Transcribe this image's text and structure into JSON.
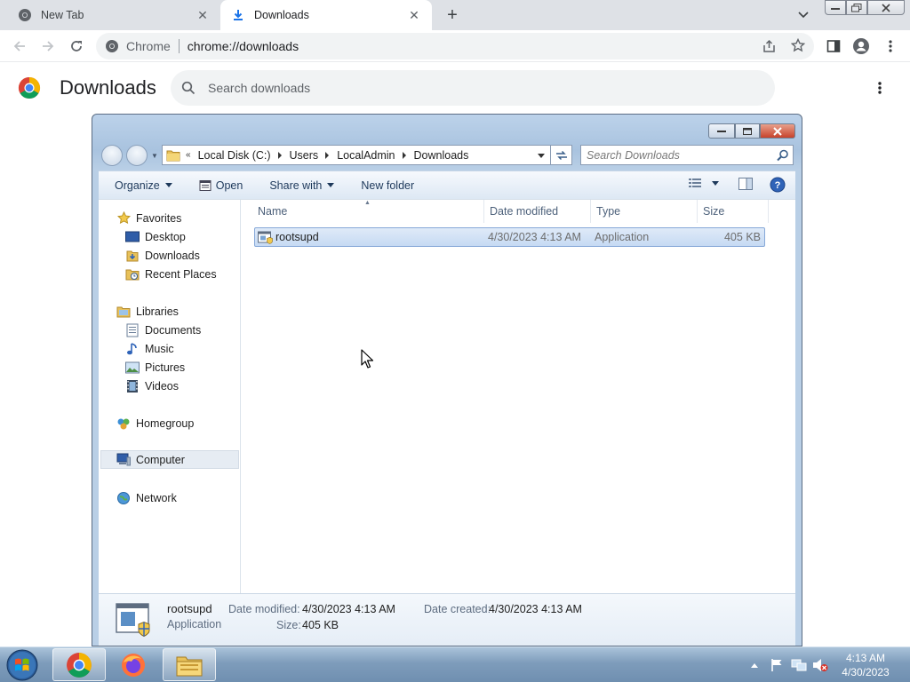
{
  "browser": {
    "tabs": [
      {
        "title": "New Tab",
        "icon": "chrome-icon",
        "active": false
      },
      {
        "title": "Downloads",
        "icon": "download-icon",
        "active": true
      }
    ],
    "omnibox": {
      "site_label": "Chrome",
      "url": "chrome://downloads"
    }
  },
  "downloads_page": {
    "title": "Downloads",
    "search_placeholder": "Search downloads"
  },
  "explorer": {
    "breadcrumb": [
      "Local Disk (C:)",
      "Users",
      "LocalAdmin",
      "Downloads"
    ],
    "search_placeholder": "Search Downloads",
    "commands": {
      "organize": "Organize",
      "open": "Open",
      "share_with": "Share with",
      "new_folder": "New folder"
    },
    "nav": {
      "favorites": "Favorites",
      "desktop": "Desktop",
      "downloads": "Downloads",
      "recent_places": "Recent Places",
      "libraries": "Libraries",
      "documents": "Documents",
      "music": "Music",
      "pictures": "Pictures",
      "videos": "Videos",
      "homegroup": "Homegroup",
      "computer": "Computer",
      "network": "Network"
    },
    "columns": {
      "name": "Name",
      "date_modified": "Date modified",
      "type": "Type",
      "size": "Size"
    },
    "files": [
      {
        "name": "rootsupd",
        "date_modified": "4/30/2023 4:13 AM",
        "type": "Application",
        "size": "405 KB"
      }
    ],
    "details": {
      "name": "rootsupd",
      "type": "Application",
      "date_modified_label": "Date modified:",
      "date_modified": "4/30/2023 4:13 AM",
      "date_created_label": "Date created:",
      "date_created": "4/30/2023 4:13 AM",
      "size_label": "Size:",
      "size": "405 KB"
    }
  },
  "taskbar": {
    "apps": [
      "chrome-icon",
      "firefox-icon",
      "explorer-icon"
    ],
    "clock_time": "4:13 AM",
    "clock_date": "4/30/2023"
  },
  "colors": {
    "chrome_tab_strip": "#dee1e6",
    "explorer_frame": "#b9cfe6",
    "selection": "#c6daf3",
    "taskbar": "#7e9cbb"
  }
}
